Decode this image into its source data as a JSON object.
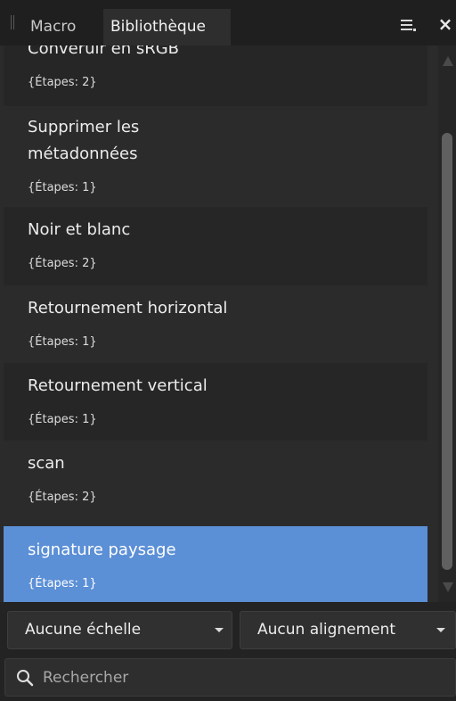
{
  "tabs": {
    "macro_label": "Macro",
    "library_label": "Bibliothèque"
  },
  "macros": [
    {
      "name": "Converuir en sRGB",
      "steps": "{Étapes: 2}"
    },
    {
      "name": "Supprimer les",
      "name2": "métadonnées",
      "steps": "{Étapes: 1}"
    },
    {
      "name": "Noir et blanc",
      "steps": "{Étapes: 2}"
    },
    {
      "name": "Retournement horizontal",
      "steps": "{Étapes: 1}"
    },
    {
      "name": "Retournement vertical",
      "steps": "{Étapes: 1}"
    },
    {
      "name": "scan",
      "steps": "{Étapes: 2}"
    },
    {
      "name": "signature paysage",
      "steps": "{Étapes: 1}"
    }
  ],
  "controls": {
    "scale_value": "Aucune échelle",
    "align_value": "Aucun alignement",
    "search_placeholder": "Rechercher"
  },
  "colors": {
    "selection": "#5b8fd6",
    "panel_bg": "#2b2b2b"
  }
}
